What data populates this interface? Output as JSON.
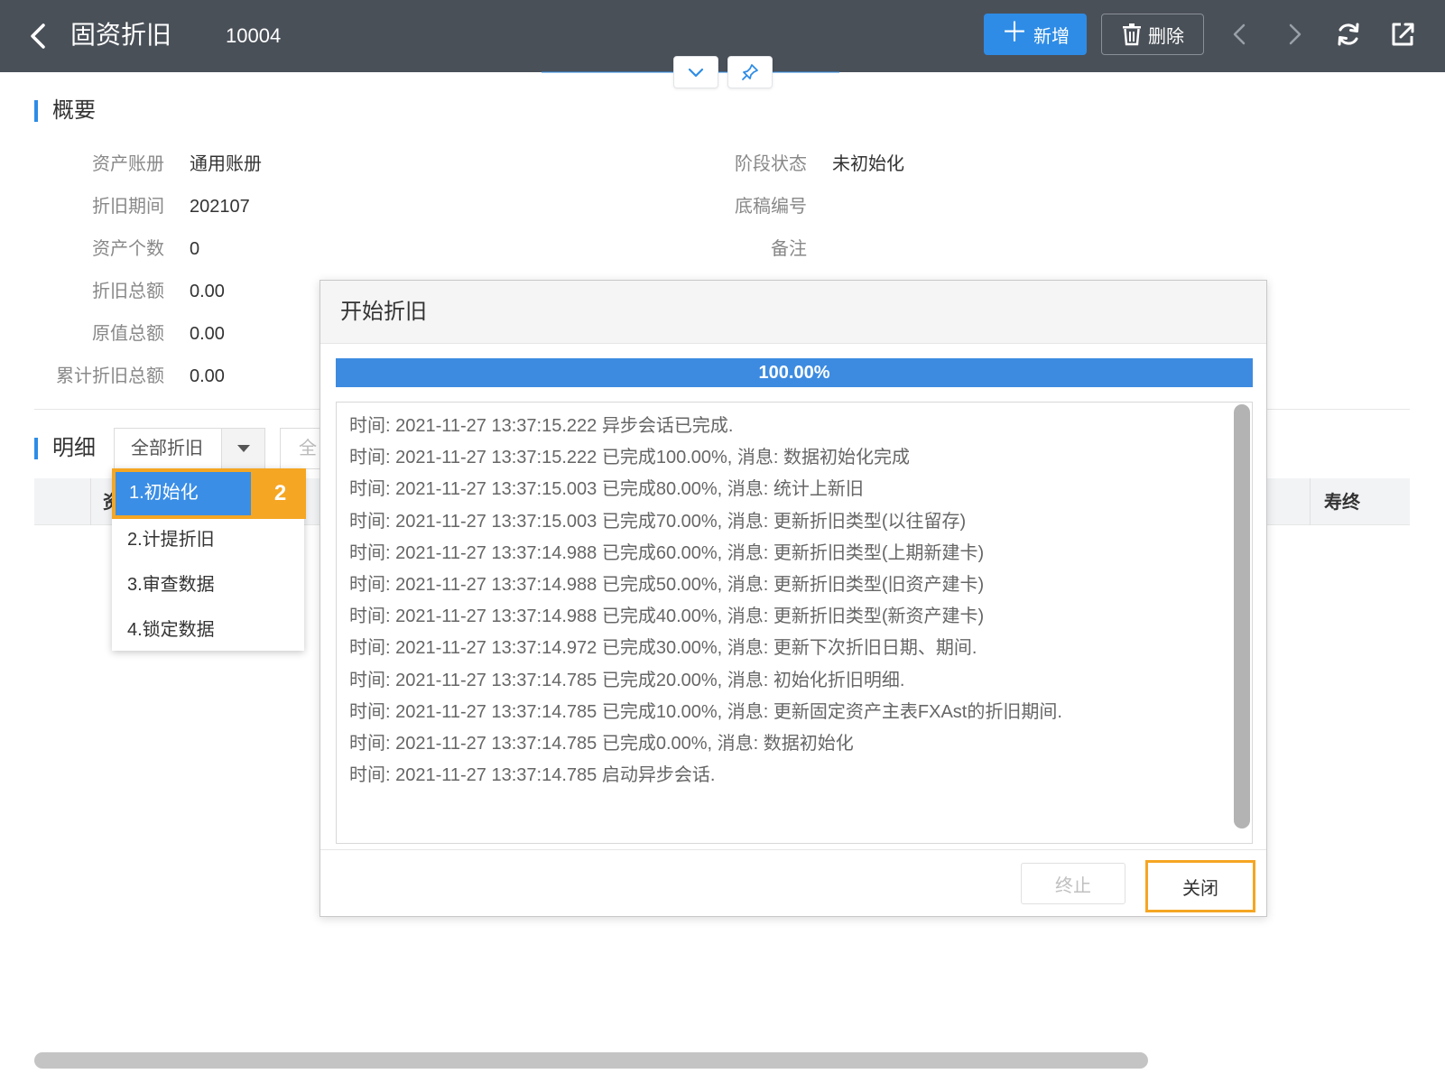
{
  "header": {
    "title": "固资折旧",
    "record_id": "10004",
    "add_label": "新增",
    "delete_label": "删除"
  },
  "overview": {
    "section_title": "概要",
    "fields": {
      "asset_book_label": "资产账册",
      "asset_book_value": "通用账册",
      "period_label": "折旧期间",
      "period_value": "202107",
      "count_label": "资产个数",
      "count_value": "0",
      "total_dep_label": "折旧总额",
      "total_dep_value": "0.00",
      "original_label": "原值总额",
      "original_value": "0.00",
      "accum_label": "累计折旧总额",
      "accum_value": "0.00",
      "stage_label": "阶段状态",
      "stage_value": "未初始化",
      "draft_label": "底稿编号",
      "remark_label": "备注"
    }
  },
  "detail": {
    "section_title": "明细",
    "filter_value": "全部折旧",
    "filter2_partial": "全",
    "col_first_partial": "资",
    "col_last": "寿终"
  },
  "dropdown": {
    "items": [
      "1.初始化",
      "2.计提折旧",
      "3.审查数据",
      "4.锁定数据"
    ],
    "step_badge": "2"
  },
  "modal": {
    "title": "开始折旧",
    "progress_value": 1.0,
    "progress_text": "100.00%",
    "log_lines": [
      "时间: 2021-11-27 13:37:15.222 异步会话已完成.",
      "时间: 2021-11-27 13:37:15.222 已完成100.00%, 消息: 数据初始化完成",
      "时间: 2021-11-27 13:37:15.003 已完成80.00%, 消息: 统计上新旧",
      "时间: 2021-11-27 13:37:15.003 已完成70.00%, 消息: 更新折旧类型(以往留存)",
      "时间: 2021-11-27 13:37:14.988 已完成60.00%, 消息: 更新折旧类型(上期新建卡)",
      "时间: 2021-11-27 13:37:14.988 已完成50.00%, 消息: 更新折旧类型(旧资产建卡)",
      "时间: 2021-11-27 13:37:14.988 已完成40.00%, 消息: 更新折旧类型(新资产建卡)",
      "时间: 2021-11-27 13:37:14.972 已完成30.00%, 消息: 更新下次折旧日期、期间.",
      "时间: 2021-11-27 13:37:14.785 已完成20.00%, 消息: 初始化折旧明细.",
      "时间: 2021-11-27 13:37:14.785 已完成10.00%, 消息: 更新固定资产主表FXAst的折旧期间.",
      "时间: 2021-11-27 13:37:14.785 已完成0.00%, 消息: 数据初始化",
      "时间: 2021-11-27 13:37:14.785 启动异步会话."
    ],
    "stop_label": "终止",
    "close_label": "关闭"
  },
  "colors": {
    "header_bg": "#4a5058",
    "accent": "#2e8ce6",
    "highlight": "#f5a623"
  },
  "icons": [
    "back-icon",
    "plus-icon",
    "trash-icon",
    "prev-icon",
    "next-icon",
    "refresh-icon",
    "share-icon",
    "chevron-down-icon",
    "pin-icon"
  ]
}
